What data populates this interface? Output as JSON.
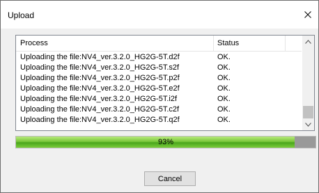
{
  "window": {
    "title": "Upload"
  },
  "list": {
    "columns": {
      "process": "Process",
      "status": "Status"
    },
    "rows": [
      {
        "process": "Uploading the file:NV4_ver.3.2.0_HG2G-5T.d2f",
        "status": "OK."
      },
      {
        "process": "Uploading the file:NV4_ver.3.2.0_HG2G-5T.s2f",
        "status": "OK."
      },
      {
        "process": "Uploading the file:NV4_ver.3.2.0_HG2G-5T.p2f",
        "status": "OK."
      },
      {
        "process": "Uploading the file:NV4_ver.3.2.0_HG2G-5T.e2f",
        "status": "OK."
      },
      {
        "process": "Uploading the file:NV4_ver.3.2.0_HG2G-5T.i2f",
        "status": "OK."
      },
      {
        "process": "Uploading the file:NV4_ver.3.2.0_HG2G-5T.c2f",
        "status": "OK."
      },
      {
        "process": "Uploading the file:NV4_ver.3.2.0_HG2G-5T.q2f",
        "status": "OK."
      }
    ]
  },
  "progress": {
    "value": 0.93,
    "label": "93%"
  },
  "buttons": {
    "cancel": "Cancel"
  },
  "icons": {
    "close": "close-icon",
    "scroll_up": "chevron-up-icon",
    "scroll_down": "chevron-down-icon"
  },
  "colors": {
    "progress_fill": "#79c73a",
    "progress_track": "#999999"
  }
}
